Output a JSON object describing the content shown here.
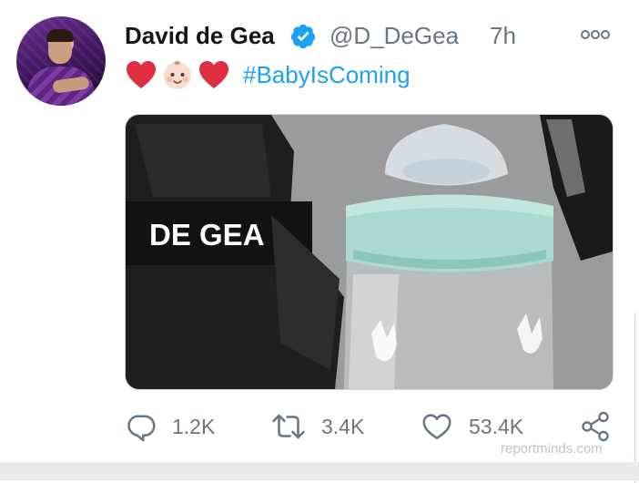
{
  "tweet": {
    "author_name": "David de Gea",
    "handle": "@D_DeGea",
    "separator": "·",
    "time": "7h",
    "emojis": [
      "red-heart",
      "baby-face",
      "red-heart"
    ],
    "hashtag": "#BabyIsComing"
  },
  "media": {
    "glove_brand_text": "DE GEA"
  },
  "actions": {
    "replies": "1.2K",
    "retweets": "3.4K",
    "likes": "53.4K"
  },
  "watermark": "reportminds.com",
  "colors": {
    "accent": "#1da1f2",
    "secondary_text": "#657786",
    "heart_red": "#e0245e"
  },
  "icons": {
    "verified": "verified-badge-icon",
    "more": "more-options-icon",
    "reply": "reply-icon",
    "retweet": "retweet-icon",
    "like": "like-icon",
    "share": "share-icon"
  }
}
